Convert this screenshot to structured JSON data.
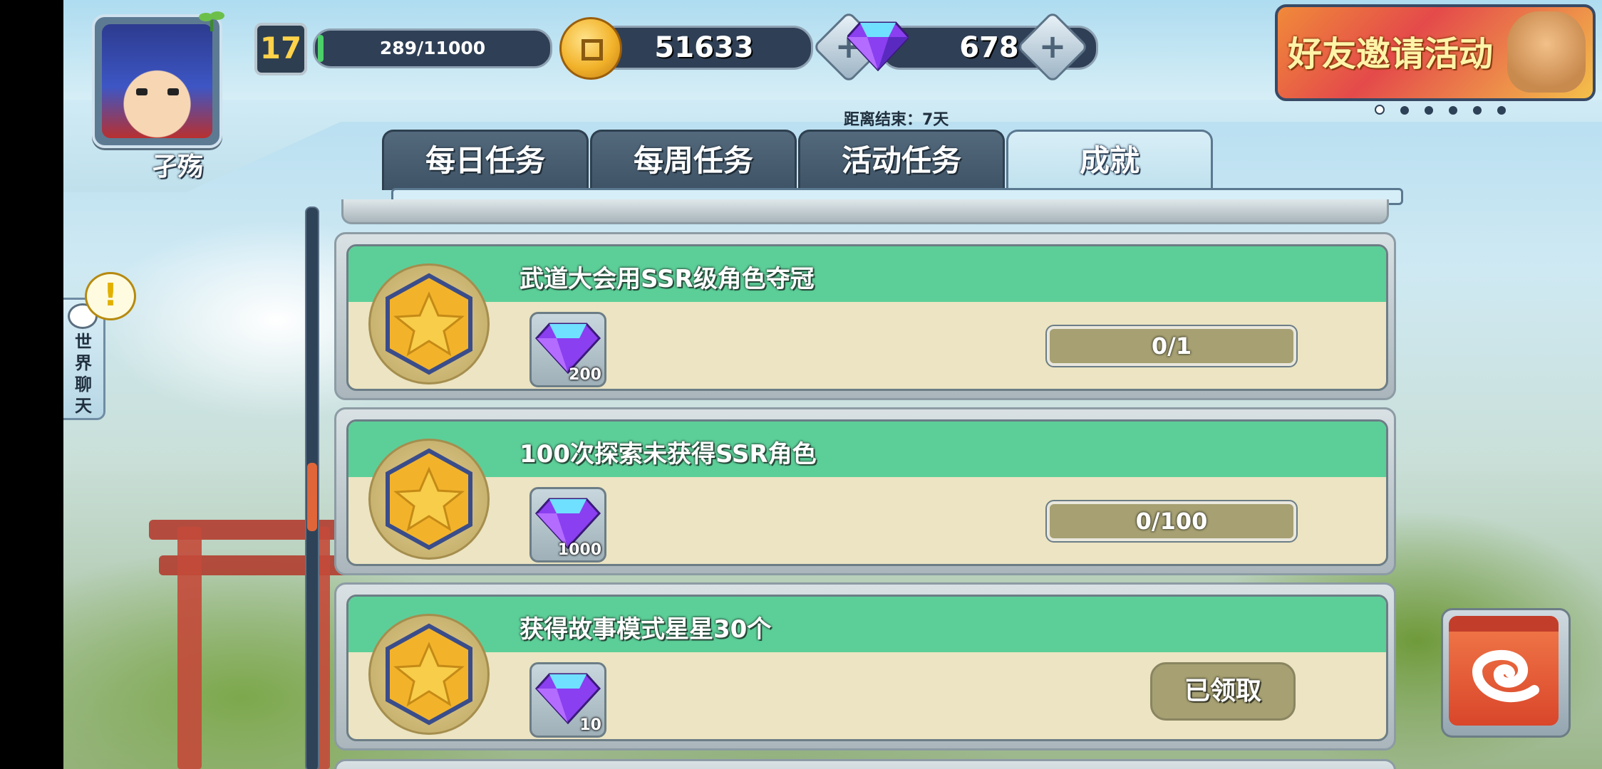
{
  "player": {
    "name": "孑殇",
    "level": "17",
    "xp": "289/11000",
    "xp_progress": 0.026
  },
  "currency": {
    "coins": "51633",
    "gems": "678"
  },
  "banner": {
    "title": "好友邀请活动",
    "page_count": 6,
    "active_page": 1
  },
  "countdown": "距离结束：7天",
  "tabs": [
    {
      "label": "每日任务",
      "active": false
    },
    {
      "label": "每周任务",
      "active": false
    },
    {
      "label": "活动任务",
      "active": false
    },
    {
      "label": "成就",
      "active": true
    }
  ],
  "chat": {
    "label": "世界聊天",
    "alert": "!"
  },
  "achievements": [
    {
      "title": "武道大会用SSR级角色夺冠",
      "reward_amount": "200",
      "progress": "0/1",
      "status": "in-progress"
    },
    {
      "title": "100次探索未获得SSR角色",
      "reward_amount": "1000",
      "progress": "0/100",
      "status": "in-progress"
    },
    {
      "title": "获得故事模式星星30个",
      "reward_amount": "10",
      "claimed_label": "已领取",
      "status": "claimed"
    }
  ],
  "colors": {
    "card_header": "#5ccf98",
    "card_body": "#ece4c2",
    "tab_inactive": "#3e5365",
    "back_button": "#d9462a"
  },
  "icons": {
    "coin": "coin-icon",
    "gem": "gem-icon",
    "medal": "star-medal-icon",
    "back": "back-swirl-icon"
  }
}
